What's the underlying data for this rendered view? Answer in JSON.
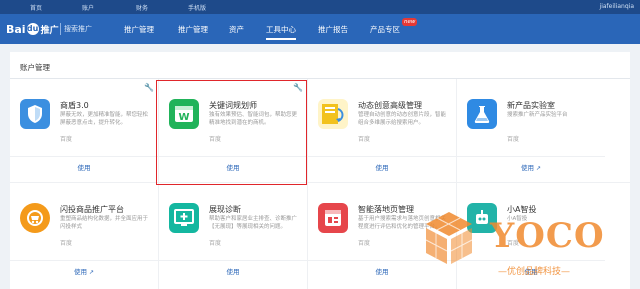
{
  "topbar": {
    "links": [
      "首页",
      "账户",
      "财务",
      "手机版"
    ],
    "user": "jiafeilianqia"
  },
  "nav": {
    "logo_text": "Bai",
    "logo_paw": "du",
    "logo_suffix": "推广",
    "subtitle": "搜索推广",
    "items": [
      "推广管理",
      "推广管理",
      "资产",
      "工具中心",
      "推广报告",
      "产品专区"
    ],
    "active_index": 3,
    "new_badge": "new"
  },
  "section": {
    "title": "账户管理"
  },
  "cards": [
    {
      "title": "商盾3.0",
      "desc": "屏蔽无效，更加精准智能，帮您轻松屏蔽恶意点击，提升转化。",
      "source": "百度",
      "use": "使用",
      "ext": "",
      "icon": "shield-icon",
      "color": "#3b8fe0",
      "wrench": true
    },
    {
      "title": "关键词规划师",
      "desc": "独有效果预估、智能词包，帮助您更精准地找到潜在的商机。",
      "source": "百度",
      "use": "使用",
      "ext": "",
      "icon": "keyword-planner-icon",
      "color": "#21b35a",
      "wrench": true
    },
    {
      "title": "动态创意高级管理",
      "desc": "管理自动创意的动态创意片段，智能组合多维展示给搜索用户。",
      "source": "百度",
      "use": "使用",
      "ext": "",
      "icon": "dynamic-creative-icon",
      "color": "#f2c21d",
      "wrench": false
    },
    {
      "title": "新产品实验室",
      "desc": "搜索推广新产品实验平台",
      "source": "百度",
      "use": "使用",
      "ext": "↗",
      "icon": "lab-flask-icon",
      "color": "#2f8ae3",
      "wrench": false
    },
    {
      "title": "闪投商品推广平台",
      "desc": "重塑商品结构化数据，并全面应用于闪投样式",
      "source": "百度",
      "use": "使用",
      "ext": "↗",
      "icon": "flash-cart-icon",
      "color": "#f49a1a",
      "wrench": false
    },
    {
      "title": "展现诊断",
      "desc": "帮助客户和家居业主排查、诊断推广【无展现】等展现相关的问题。",
      "source": "百度",
      "use": "使用",
      "ext": "",
      "icon": "display-diagnosis-icon",
      "color": "#14b7a0",
      "wrench": false
    },
    {
      "title": "智能落地页管理",
      "desc": "基于用户搜索需求与落地页创意相关程度进行评估和优化的管理平台。",
      "source": "百度",
      "use": "使用",
      "ext": "",
      "icon": "landing-page-icon",
      "color": "#e6464b",
      "wrench": false
    },
    {
      "title": "小A智投",
      "desc": "小A智投",
      "source": "百度",
      "use": "使用",
      "ext": "",
      "icon": "robot-icon",
      "color": "#22b3a8",
      "wrench": false
    }
  ],
  "watermark": {
    "brand": "YOCO",
    "slogan": "—优创品牌科技—"
  }
}
